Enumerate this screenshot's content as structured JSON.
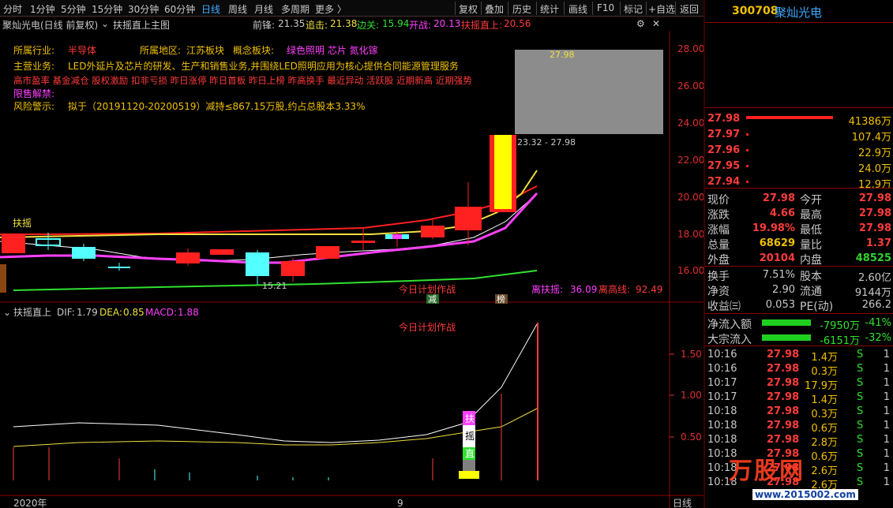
{
  "toolbar": {
    "periods": [
      "分时",
      "1分钟",
      "5分钟",
      "15分钟",
      "30分钟",
      "60分钟",
      "日线",
      "周线",
      "月线",
      "多周期",
      "更多 〉"
    ],
    "active_period": "日线",
    "actions": [
      "复权",
      "叠加",
      "历史",
      "统计",
      "画线",
      "F10",
      "标记",
      "+自选",
      "返回"
    ]
  },
  "title_row": {
    "stock_period": "聚灿光电(日线 前复权)",
    "indicator": "扶摇直上主图",
    "qianfeng_label": "前锋:",
    "qianfeng_value": "21.35",
    "zhuiji_label": "追击:",
    "zhuiji_value": "21.38",
    "biangua_label": "边关:",
    "biangua_value": "15.94",
    "kaizhan_label": "开战:",
    "kaizhan_value": "20.13",
    "fuyao_label": "扶摇直上:",
    "fuyao_value": "20.56"
  },
  "info": {
    "industry_label": "所属行业:",
    "industry_value": "半导体",
    "region_label": "所属地区:",
    "region_value": "江苏板块",
    "concept_label": "概念板块:",
    "concept_value": "绿色照明 芯片 氮化镓",
    "business_label": "主营业务:",
    "business_value": "LED外延片及芯片的研发、生产和销售业务,并围绕LED照明应用为核心提供合同能源管理服务",
    "tags": "高市盈率 基金减仓 股权激励 扣非亏损 昨日涨停 昨日首板 昨日上榜 昨高换手 最近异动 活跃股 近期新高 近期强势",
    "restricted_label": "限售解禁:",
    "risk_label": "风险警示:",
    "risk_value": "拟于（20191120-20200519）减持≤867.15万股,约占总股本3.33%"
  },
  "main_chart": {
    "y_ticks": [
      "28.00",
      "26.00",
      "24.00",
      "22.00",
      "20.00",
      "18.00",
      "16.00"
    ],
    "box_top_label": "27.98",
    "box_range_label": "23.32 - 27.98",
    "low_label": "15.21",
    "fuyao_marker": "扶摇",
    "plan_label": "今日计划作战",
    "jian_marker": "减",
    "bang_marker": "榜",
    "li_fuyao_label": "离扶摇:",
    "li_fuyao_value": "36.09",
    "li_gao_label": "离高线:",
    "li_gao_value": "92.49"
  },
  "sub_chart": {
    "name": "扶摇直上",
    "dif_label": "DIF:",
    "dif_value": "1.79",
    "dea_label": "DEA:",
    "dea_value": "0.85",
    "macd_label": "MACD:",
    "macd_value": "1.88",
    "y_ticks": [
      "1.50",
      "1.00",
      "0.50"
    ],
    "plan_label": "今日计划作战",
    "vertical_text": [
      "扶",
      "摇",
      "直"
    ]
  },
  "bottom": {
    "year_label": "2020年",
    "month_label": "9",
    "period_label": "日线"
  },
  "watermark": {
    "main": "万股网",
    "url": "www.2015002.com"
  },
  "right_panel": {
    "code": "300708",
    "name": "聚灿光电",
    "asks": [
      {
        "price": "27.98",
        "qty": "41386万"
      },
      {
        "price": "27.97",
        "qty": "107.4万"
      },
      {
        "price": "27.96",
        "qty": "22.9万"
      },
      {
        "price": "27.95",
        "qty": "24.0万"
      },
      {
        "price": "27.94",
        "qty": "12.9万"
      }
    ],
    "stats": [
      {
        "l1": "现价",
        "v1": "27.98",
        "l2": "今开",
        "v2": "27.98",
        "c1": "#ff3b3b",
        "c2": "#ff3b3b"
      },
      {
        "l1": "涨跌",
        "v1": "4.66",
        "l2": "最高",
        "v2": "27.98",
        "c1": "#ff3b3b",
        "c2": "#ff3b3b"
      },
      {
        "l1": "涨幅",
        "v1": "19.98%",
        "l2": "最低",
        "v2": "27.98",
        "c1": "#ff3b3b",
        "c2": "#ff3b3b"
      },
      {
        "l1": "总量",
        "v1": "68629",
        "l2": "量比",
        "v2": "1.37",
        "c1": "#f0c000",
        "c2": "#ff3b3b"
      },
      {
        "l1": "外盘",
        "v1": "20104",
        "l2": "内盘",
        "v2": "48525",
        "c1": "#ff3b3b",
        "c2": "#30d030"
      }
    ],
    "stats2": [
      {
        "l1": "换手",
        "v1": "7.51%",
        "l2": "股本",
        "v2": "2.60亿"
      },
      {
        "l1": "净资",
        "v1": "2.90",
        "l2": "流通",
        "v2": "9144万"
      },
      {
        "l1": "收益㈢",
        "v1": "0.053",
        "l2": "PE(动)",
        "v2": "266.2"
      }
    ],
    "flows": [
      {
        "label": "净流入额",
        "value": "-7950万",
        "pct": "-41%"
      },
      {
        "label": "大宗流入",
        "value": "-6151万",
        "pct": "-32%"
      }
    ],
    "ticks": [
      {
        "time": "10:16",
        "price": "27.98",
        "vol": "1.4万",
        "side": "S",
        "n": "1"
      },
      {
        "time": "10:16",
        "price": "27.98",
        "vol": "0.3万",
        "side": "S",
        "n": "1"
      },
      {
        "time": "10:17",
        "price": "27.98",
        "vol": "17.9万",
        "side": "S",
        "n": "1"
      },
      {
        "time": "10:17",
        "price": "27.98",
        "vol": "1.4万",
        "side": "S",
        "n": "1"
      },
      {
        "time": "10:18",
        "price": "27.98",
        "vol": "0.3万",
        "side": "S",
        "n": "1"
      },
      {
        "time": "10:18",
        "price": "27.98",
        "vol": "0.6万",
        "side": "S",
        "n": "1"
      },
      {
        "time": "10:18",
        "price": "27.98",
        "vol": "2.8万",
        "side": "S",
        "n": "1"
      },
      {
        "time": "10:18",
        "price": "27.98",
        "vol": "0.6万",
        "side": "S",
        "n": "1"
      },
      {
        "time": "10:18",
        "price": "27.98",
        "vol": "2.6万",
        "side": "S",
        "n": "1"
      },
      {
        "time": "10:18",
        "price": "27.98",
        "vol": "2.6万",
        "side": "S",
        "n": "1"
      }
    ]
  },
  "colors": {
    "up": "#ff3b3b",
    "down": "#54ffff",
    "yellow": "#f0e040",
    "magenta": "#ff40ff",
    "green": "#30e030",
    "label_blue": "#3fa9ff"
  }
}
